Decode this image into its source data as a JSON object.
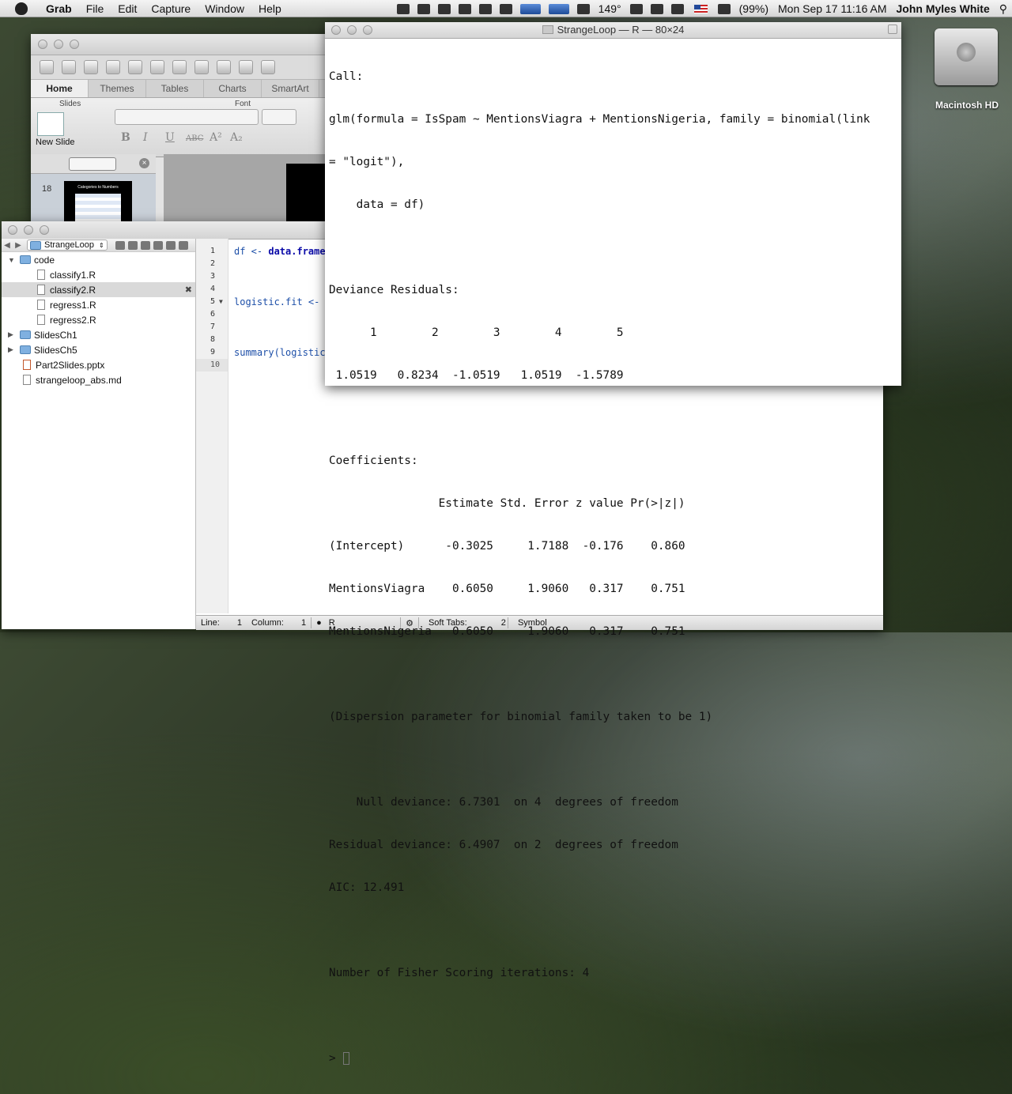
{
  "menubar": {
    "app_name": "Grab",
    "items": [
      "File",
      "Edit",
      "Capture",
      "Window",
      "Help"
    ],
    "temperature": "149°",
    "battery": "(99%)",
    "datetime": "Mon Sep 17  11:16 AM",
    "user": "John Myles White"
  },
  "desktop": {
    "drive_label": "Macintosh HD"
  },
  "powerpoint": {
    "tabs": [
      "Home",
      "Themes",
      "Tables",
      "Charts",
      "SmartArt"
    ],
    "group_slides": "Slides",
    "group_font": "Font",
    "new_slide_label": "New Slide",
    "slide_number": "18",
    "thumbnail_title": "Categories to Numbers"
  },
  "editor": {
    "project": "StrangeLoop",
    "tree": [
      {
        "label": "code",
        "type": "folder",
        "expanded": true
      },
      {
        "label": "classify1.R",
        "type": "file"
      },
      {
        "label": "classify2.R",
        "type": "file",
        "selected": true
      },
      {
        "label": "regress1.R",
        "type": "file"
      },
      {
        "label": "regress2.R",
        "type": "file"
      },
      {
        "label": "SlidesCh1",
        "type": "folder"
      },
      {
        "label": "SlidesCh5",
        "type": "folder"
      },
      {
        "label": "Part2Slides.pptx",
        "type": "file"
      },
      {
        "label": "strangeloop_abs.md",
        "type": "file"
      }
    ],
    "line_numbers": [
      "1",
      "2",
      "3",
      "4",
      "5",
      "6",
      "7",
      "8",
      "9",
      "10"
    ],
    "code_lines": {
      "l1_a": "df <- ",
      "l1_b": "data.frame",
      "l5": "logistic.fit <-",
      "l9": "summary(logistic"
    },
    "status": {
      "line_label": "Line:",
      "line_value": "1",
      "column_label": "Column:",
      "column_value": "1",
      "language": "R",
      "soft_tabs_label": "Soft Tabs:",
      "soft_tabs_value": "2",
      "symbol": "Symbol"
    }
  },
  "rconsole": {
    "title": "StrangeLoop — R — 80×24",
    "lines": [
      "Call:",
      "glm(formula = IsSpam ~ MentionsViagra + MentionsNigeria, family = binomial(link",
      "= \"logit\"),",
      "    data = df)",
      "",
      "Deviance Residuals:",
      "      1        2        3        4        5",
      " 1.0519   0.8234  -1.0519   1.0519  -1.5789",
      "",
      "Coefficients:",
      "                Estimate Std. Error z value Pr(>|z|)",
      "(Intercept)      -0.3025     1.7188  -0.176    0.860",
      "MentionsViagra    0.6050     1.9060   0.317    0.751",
      "MentionsNigeria   0.6050     1.9060   0.317    0.751",
      "",
      "(Dispersion parameter for binomial family taken to be 1)",
      "",
      "    Null deviance: 6.7301  on 4  degrees of freedom",
      "Residual deviance: 6.4907  on 2  degrees of freedom",
      "AIC: 12.491",
      "",
      "Number of Fisher Scoring iterations: 4",
      ""
    ],
    "prompt": ">"
  }
}
